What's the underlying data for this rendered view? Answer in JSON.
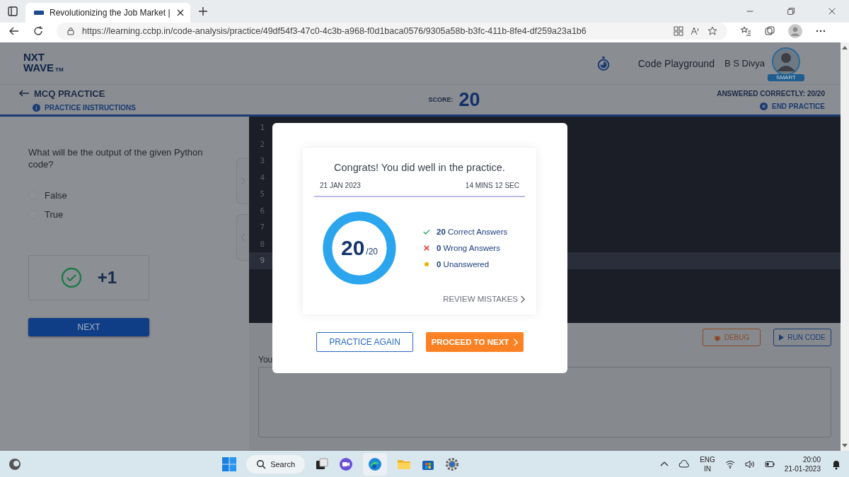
{
  "browser": {
    "tab_title": "Revolutionizing the Job Market |",
    "url": "https://learning.ccbp.in/code-analysis/practice/49df54f3-47c0-4c3b-a968-f0d1baca0576/9305a58b-b3fc-411b-8fe4-df259a23a1b6"
  },
  "header": {
    "logo_top": "NXT",
    "logo_bottom": "WAVE",
    "logo_mark": "TM",
    "link": "Code Playground",
    "user": "B S Divya",
    "badge": "SMART"
  },
  "practice_bar": {
    "title": "MCQ PRACTICE",
    "instructions": "PRACTICE INSTRUCTIONS",
    "score_label": "SCORE:",
    "score": "20",
    "answered": "ANSWERED CORRECTLY: 20/20",
    "end": "END PRACTICE"
  },
  "question": {
    "text": "What will be the output of the given Python code?",
    "options": [
      {
        "label": "False",
        "selected": false
      },
      {
        "label": "True",
        "selected": false
      }
    ],
    "result": "+1",
    "next": "NEXT"
  },
  "editor": {
    "lines": [
      {
        "number": "1",
        "selected": false
      },
      {
        "number": "2",
        "selected": false
      },
      {
        "number": "3",
        "selected": false
      },
      {
        "number": "4",
        "selected": false
      },
      {
        "number": "5",
        "selected": false
      },
      {
        "number": "6",
        "selected": false
      },
      {
        "number": "7",
        "selected": false
      },
      {
        "number": "8",
        "selected": false
      },
      {
        "number": "9",
        "selected": true
      }
    ]
  },
  "console": {
    "debug": "DEBUG",
    "run": "RUN CODE",
    "label": "You"
  },
  "modal": {
    "title": "Congrats! You did well in the practice.",
    "date": "21 JAN 2023",
    "duration": "14 MINS 12 SEC",
    "score": "20",
    "total": "/20",
    "level": 1,
    "stats": [
      {
        "kind": "correct",
        "text": "**20** Correct Answers"
      },
      {
        "kind": "wrong",
        "text": "**0** Wrong Answers"
      },
      {
        "kind": "unanswered",
        "text": "**0** Unanswered"
      }
    ],
    "review": "REVIEW MISTAKES",
    "again": "PRACTICE AGAIN",
    "proceed": "PROCEED TO NEXT"
  },
  "taskbar": {
    "search": "Search",
    "lang": "ENG",
    "region": "IN",
    "time": "20:00",
    "date": "21-01-2023"
  }
}
